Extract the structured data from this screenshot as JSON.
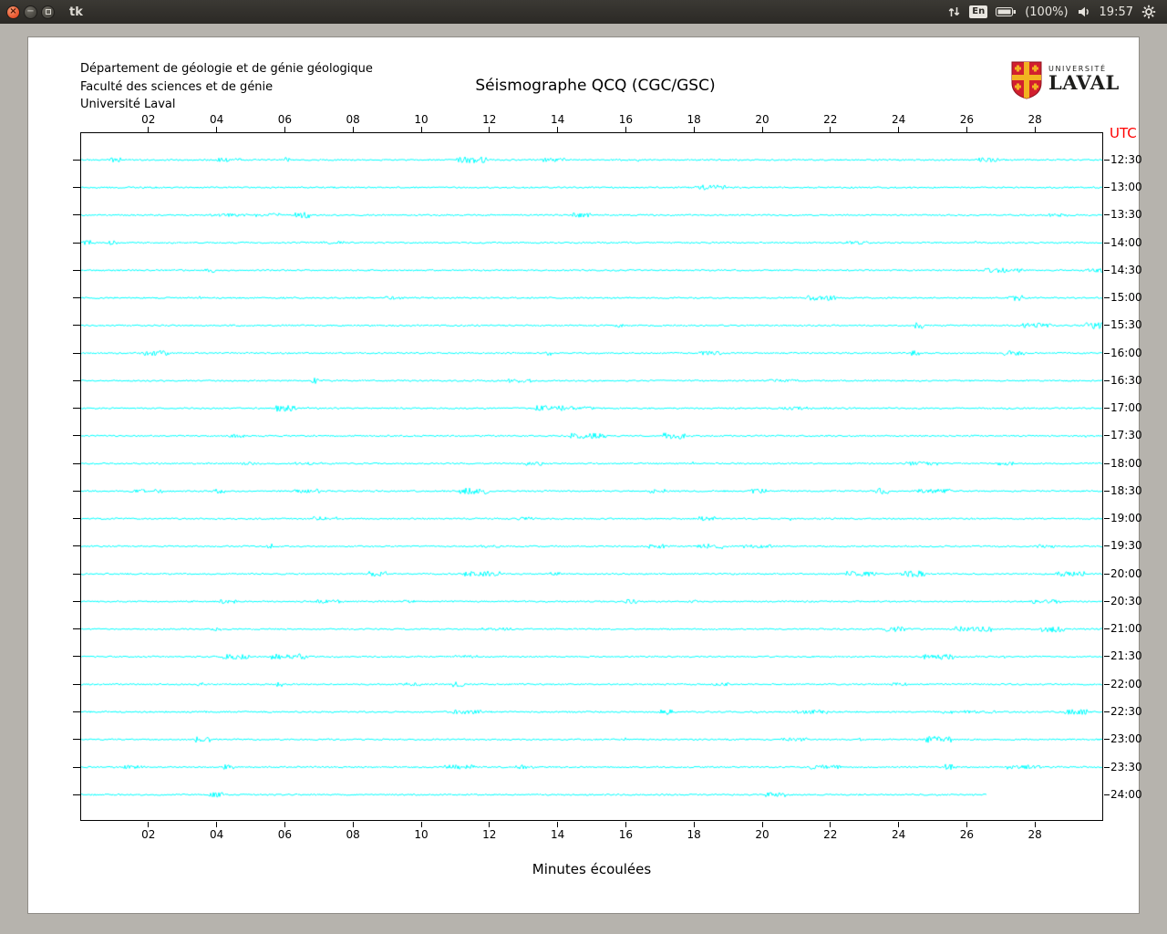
{
  "titlebar": {
    "window_title": "tk",
    "keyboard_indicator": "En",
    "battery_label": "(100%)",
    "clock": "19:57"
  },
  "header": {
    "institution_lines": [
      "Département de géologie et de génie géologique",
      "Faculté des sciences et de génie",
      "Université Laval"
    ],
    "title": "Séismographe QCQ (CGC/GSC)",
    "logo": {
      "top": "UNIVERSITÉ",
      "name": "LAVAL",
      "shield_red": "#d21f2e",
      "gold": "#f2b321"
    }
  },
  "chart_data": {
    "type": "line",
    "subtype": "helicorder-seismogram",
    "title": "Séismographe QCQ (CGC/GSC)",
    "xlabel": "Minutes écoulées",
    "right_axis_label": "UTC",
    "x_range_minutes": [
      0,
      30
    ],
    "x_ticks": [
      "02",
      "04",
      "06",
      "08",
      "10",
      "12",
      "14",
      "16",
      "18",
      "20",
      "22",
      "24",
      "26",
      "28"
    ],
    "x_tick_minutes": [
      2,
      4,
      6,
      8,
      10,
      12,
      14,
      16,
      18,
      20,
      22,
      24,
      26,
      28
    ],
    "grid": false,
    "trace_color": "#00ffff",
    "utc_label_color": "#ff0000",
    "traces": [
      {
        "utc": "12:30",
        "start_min": 0,
        "end_min": 30
      },
      {
        "utc": "13:00",
        "start_min": 0,
        "end_min": 30
      },
      {
        "utc": "13:30",
        "start_min": 0,
        "end_min": 30
      },
      {
        "utc": "14:00",
        "start_min": 0,
        "end_min": 30
      },
      {
        "utc": "14:30",
        "start_min": 0,
        "end_min": 30
      },
      {
        "utc": "15:00",
        "start_min": 0,
        "end_min": 30
      },
      {
        "utc": "15:30",
        "start_min": 0,
        "end_min": 30
      },
      {
        "utc": "16:00",
        "start_min": 0,
        "end_min": 30
      },
      {
        "utc": "16:30",
        "start_min": 0,
        "end_min": 30
      },
      {
        "utc": "17:00",
        "start_min": 0,
        "end_min": 30
      },
      {
        "utc": "17:30",
        "start_min": 0,
        "end_min": 30
      },
      {
        "utc": "18:00",
        "start_min": 0,
        "end_min": 30
      },
      {
        "utc": "18:30",
        "start_min": 0,
        "end_min": 30
      },
      {
        "utc": "19:00",
        "start_min": 0,
        "end_min": 30
      },
      {
        "utc": "19:30",
        "start_min": 0,
        "end_min": 30
      },
      {
        "utc": "20:00",
        "start_min": 0,
        "end_min": 30
      },
      {
        "utc": "20:30",
        "start_min": 0,
        "end_min": 30
      },
      {
        "utc": "21:00",
        "start_min": 0,
        "end_min": 30
      },
      {
        "utc": "21:30",
        "start_min": 0,
        "end_min": 30
      },
      {
        "utc": "22:00",
        "start_min": 0,
        "end_min": 30
      },
      {
        "utc": "22:30",
        "start_min": 0,
        "end_min": 30
      },
      {
        "utc": "23:00",
        "start_min": 0,
        "end_min": 30
      },
      {
        "utc": "23:30",
        "start_min": 0,
        "end_min": 30
      },
      {
        "utc": "24:00",
        "start_min": 0,
        "end_min": 26.6
      }
    ]
  }
}
